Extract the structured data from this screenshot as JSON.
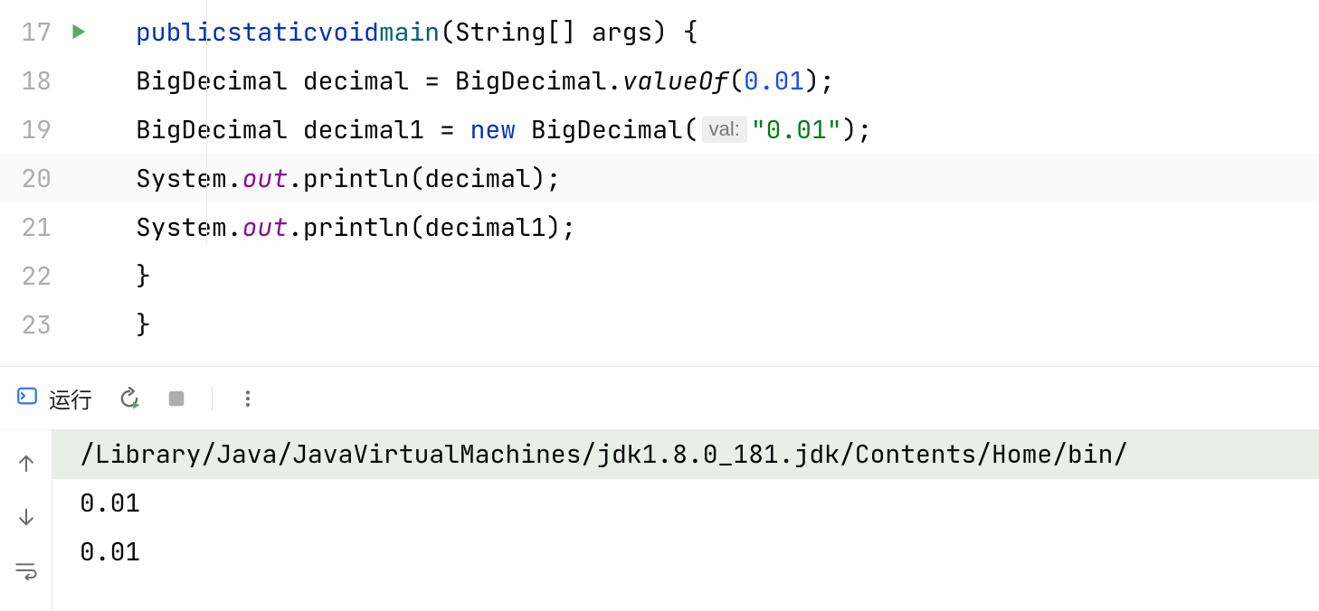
{
  "editor": {
    "lines": [
      {
        "num": "17",
        "hasRun": true
      },
      {
        "num": "18"
      },
      {
        "num": "19"
      },
      {
        "num": "20",
        "highlighted": true
      },
      {
        "num": "21"
      },
      {
        "num": "22"
      },
      {
        "num": "23"
      }
    ],
    "code": {
      "l17": {
        "kw_public": "public",
        "kw_static": "static",
        "kw_void": "void",
        "method": "main",
        "params": "(String[] args) {"
      },
      "l18": {
        "t1": "BigDecimal decimal = BigDecimal.",
        "static_method": "valueOf",
        "t2": "(",
        "num": "0.01",
        "t3": ");"
      },
      "l19": {
        "t1": "BigDecimal decimal1 = ",
        "kw_new": "new",
        "t2": " BigDecimal(",
        "hint": "val:",
        "str": "\"0.01\"",
        "t3": ");"
      },
      "l20": {
        "t1": "System.",
        "out": "out",
        "t2": ".println(decimal);"
      },
      "l21": {
        "t1": "System.",
        "out": "out",
        "t2": ".println(decimal1);"
      },
      "l22": {
        "t": "}"
      },
      "l23": {
        "t": "}"
      }
    }
  },
  "runPanel": {
    "label": "运行",
    "console": {
      "command": "/Library/Java/JavaVirtualMachines/jdk1.8.0_181.jdk/Contents/Home/bin/",
      "out1": "0.01",
      "out2": "0.01"
    }
  }
}
